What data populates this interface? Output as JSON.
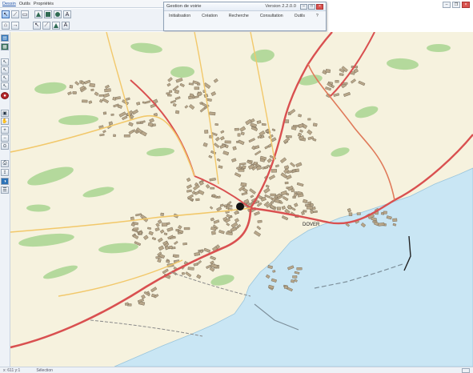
{
  "palette": {
    "menus": [
      "Dessin",
      "Outils",
      "Propriétés"
    ],
    "active_menu_index": 0
  },
  "app_window": {
    "title": "Gestion de voirie",
    "version": "Version 2.2.0.0",
    "menus": [
      "Initialisation",
      "Création",
      "Recherche",
      "Consultation",
      "Outils",
      "?"
    ]
  },
  "map": {
    "place_label": "DOVER",
    "colors": {
      "land": "#f6f2de",
      "sea": "#c9e6f4",
      "green": "#a8d590",
      "building": "#b8a78a",
      "building_outline": "#6e6250",
      "major_road": "#d95050",
      "minor_road": "#f2c86a",
      "rail": "#8a8a8a"
    }
  },
  "statusbar": {
    "left_text": "x: 611 y:1",
    "mid_text": "Sélection"
  }
}
